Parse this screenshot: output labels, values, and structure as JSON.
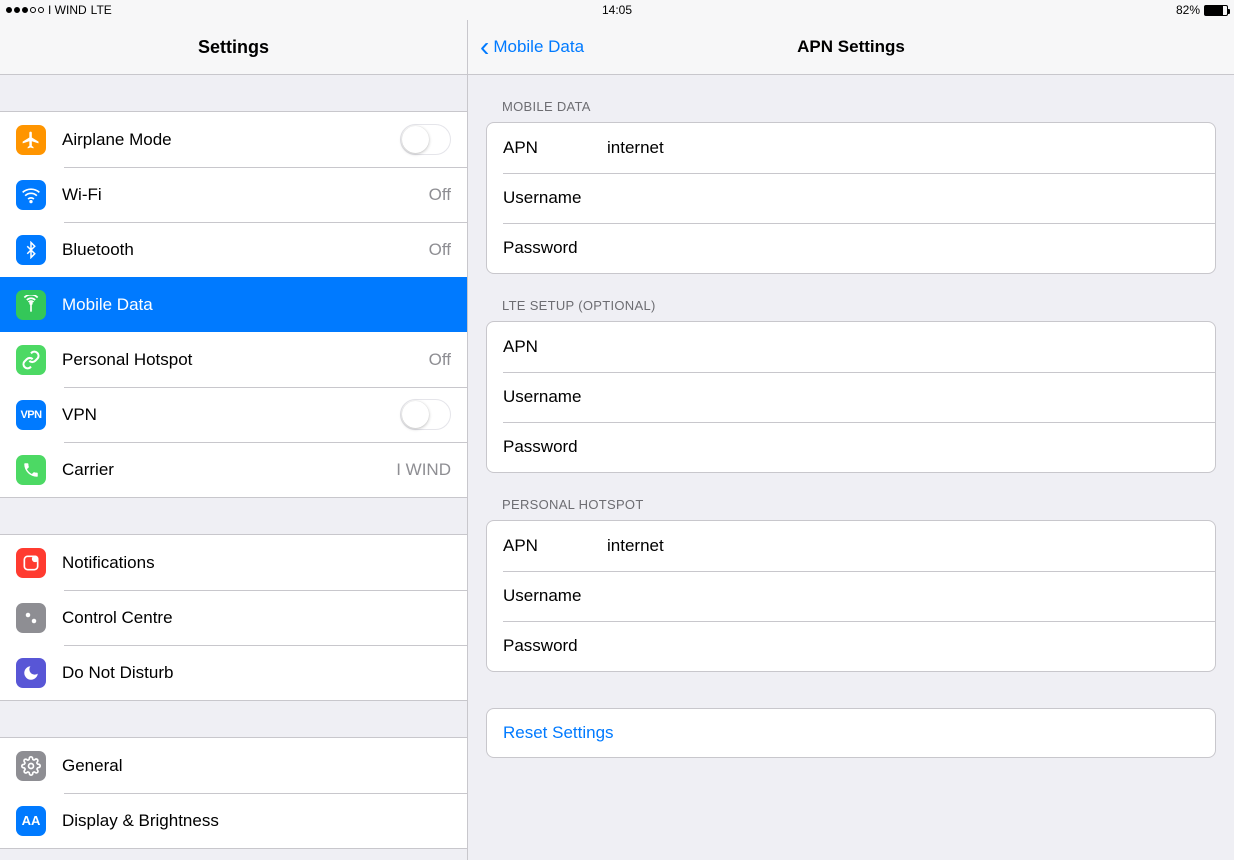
{
  "status_bar": {
    "carrier": "I WIND",
    "network": "LTE",
    "time": "14:05",
    "battery_pct": "82%"
  },
  "sidebar": {
    "title": "Settings",
    "groups": [
      {
        "items": [
          {
            "id": "airplane",
            "label": "Airplane Mode",
            "type": "toggle",
            "icon": "airplane",
            "color": "ic-orange",
            "on": false
          },
          {
            "id": "wifi",
            "label": "Wi-Fi",
            "type": "detail",
            "icon": "wifi",
            "color": "ic-blue",
            "detail": "Off"
          },
          {
            "id": "bluetooth",
            "label": "Bluetooth",
            "type": "detail",
            "icon": "bluetooth",
            "color": "ic-blue",
            "detail": "Off"
          },
          {
            "id": "mobiledata",
            "label": "Mobile Data",
            "type": "nav",
            "icon": "antenna",
            "color": "ic-greenant",
            "selected": true
          },
          {
            "id": "hotspot",
            "label": "Personal Hotspot",
            "type": "detail",
            "icon": "link",
            "color": "ic-green",
            "detail": "Off"
          },
          {
            "id": "vpn",
            "label": "VPN",
            "type": "toggle",
            "icon": "vpn",
            "color": "ic-blue",
            "on": false
          },
          {
            "id": "carrier",
            "label": "Carrier",
            "type": "detail",
            "icon": "phone",
            "color": "ic-green",
            "detail": "I WIND"
          }
        ]
      },
      {
        "items": [
          {
            "id": "notifications",
            "label": "Notifications",
            "type": "nav",
            "icon": "notif",
            "color": "ic-red"
          },
          {
            "id": "controlcentre",
            "label": "Control Centre",
            "type": "nav",
            "icon": "control",
            "color": "ic-grey"
          },
          {
            "id": "dnd",
            "label": "Do Not Disturb",
            "type": "nav",
            "icon": "moon",
            "color": "ic-indigo"
          }
        ]
      },
      {
        "items": [
          {
            "id": "general",
            "label": "General",
            "type": "nav",
            "icon": "gear",
            "color": "ic-grey"
          },
          {
            "id": "display",
            "label": "Display & Brightness",
            "type": "nav",
            "icon": "aa",
            "color": "ic-blue"
          }
        ]
      }
    ]
  },
  "detail": {
    "back_label": "Mobile Data",
    "title": "APN Settings",
    "sections": [
      {
        "header": "MOBILE DATA",
        "fields": [
          {
            "label": "APN",
            "value": "internet"
          },
          {
            "label": "Username",
            "value": ""
          },
          {
            "label": "Password",
            "value": ""
          }
        ]
      },
      {
        "header": "LTE SETUP (OPTIONAL)",
        "fields": [
          {
            "label": "APN",
            "value": ""
          },
          {
            "label": "Username",
            "value": ""
          },
          {
            "label": "Password",
            "value": ""
          }
        ]
      },
      {
        "header": "PERSONAL HOTSPOT",
        "fields": [
          {
            "label": "APN",
            "value": "internet"
          },
          {
            "label": "Username",
            "value": ""
          },
          {
            "label": "Password",
            "value": ""
          }
        ]
      }
    ],
    "reset_label": "Reset Settings"
  }
}
